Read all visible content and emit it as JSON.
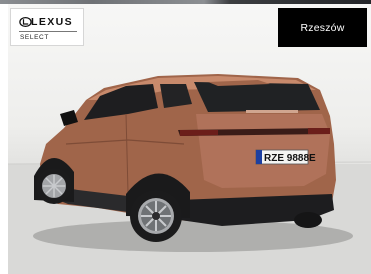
{
  "brand": {
    "name": "LEXUS",
    "subtitle": "SELECT",
    "icon": "lexus-logo-icon"
  },
  "location_button": {
    "label": "Rzeszów"
  },
  "vehicle": {
    "plate": "RZE 9888E",
    "body_color": "#a46a4f",
    "icon": "car-photo"
  },
  "colors": {
    "button_background": "#000000",
    "button_text": "#ffffff"
  }
}
